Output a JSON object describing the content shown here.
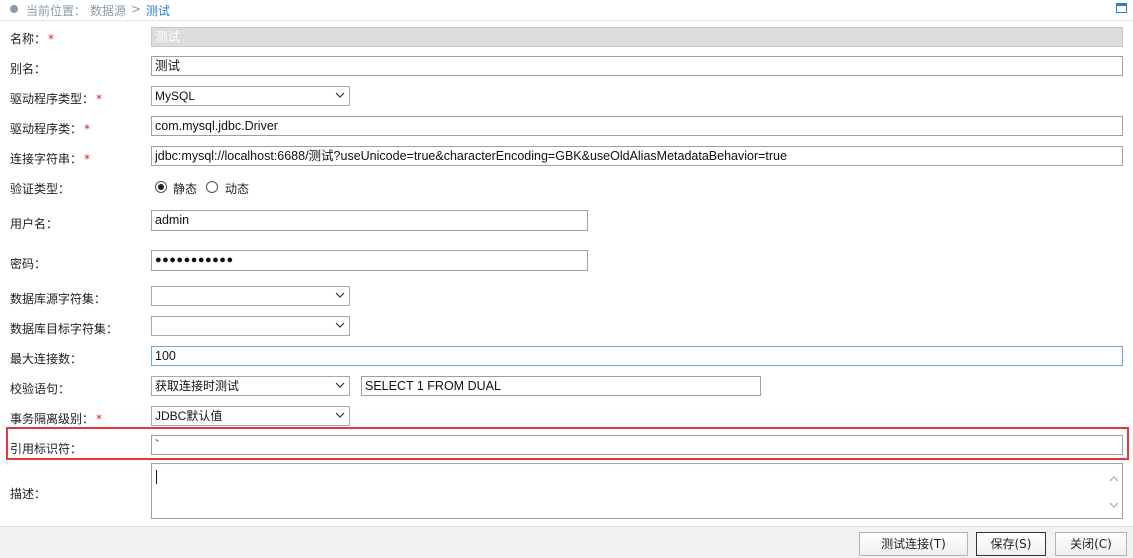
{
  "breadcrumb": {
    "prefix": "当前位置：",
    "section": "数据源",
    "separator": ">",
    "current": "测试"
  },
  "form": {
    "name": {
      "label": "名称：",
      "required": "*",
      "value": "测试"
    },
    "alias": {
      "label": "别名：",
      "value": "测试"
    },
    "driver_type": {
      "label": "驱动程序类型：",
      "required": "*",
      "value": "MySQL"
    },
    "driver_class": {
      "label": "驱动程序类：",
      "required": "*",
      "value": "com.mysql.jdbc.Driver"
    },
    "connection_string": {
      "label": "连接字符串：",
      "required": "*",
      "value": "jdbc:mysql://localhost:6688/测试?useUnicode=true&characterEncoding=GBK&useOldAliasMetadataBehavior=true"
    },
    "auth_type": {
      "label": "验证类型：",
      "options": [
        "静态",
        "动态"
      ],
      "selected": "静态"
    },
    "username": {
      "label": "用户名：",
      "value": "admin"
    },
    "password": {
      "label": "密码：",
      "value": "●●●●●●●●●●●"
    },
    "db_source_charset": {
      "label": "数据库源字符集：",
      "value": ""
    },
    "db_target_charset": {
      "label": "数据库目标字符集：",
      "value": ""
    },
    "max_connections": {
      "label": "最大连接数：",
      "value": "100"
    },
    "validation_query": {
      "label": "校验语句：",
      "mode": "获取连接时测试",
      "value": "SELECT 1 FROM DUAL"
    },
    "isolation_level": {
      "label": "事务隔离级别：",
      "required": "*",
      "value": "JDBC默认值"
    },
    "quote_identifier": {
      "label": "引用标识符：",
      "value": "`"
    },
    "description": {
      "label": "描述：",
      "value": ""
    }
  },
  "footer": {
    "test_button": "测试连接(T)",
    "save_button": "保存(S)",
    "close_button": "关闭(C)"
  },
  "colors": {
    "accent": "#2a7fc9",
    "required": "#e02020",
    "highlight": "#e53939"
  }
}
